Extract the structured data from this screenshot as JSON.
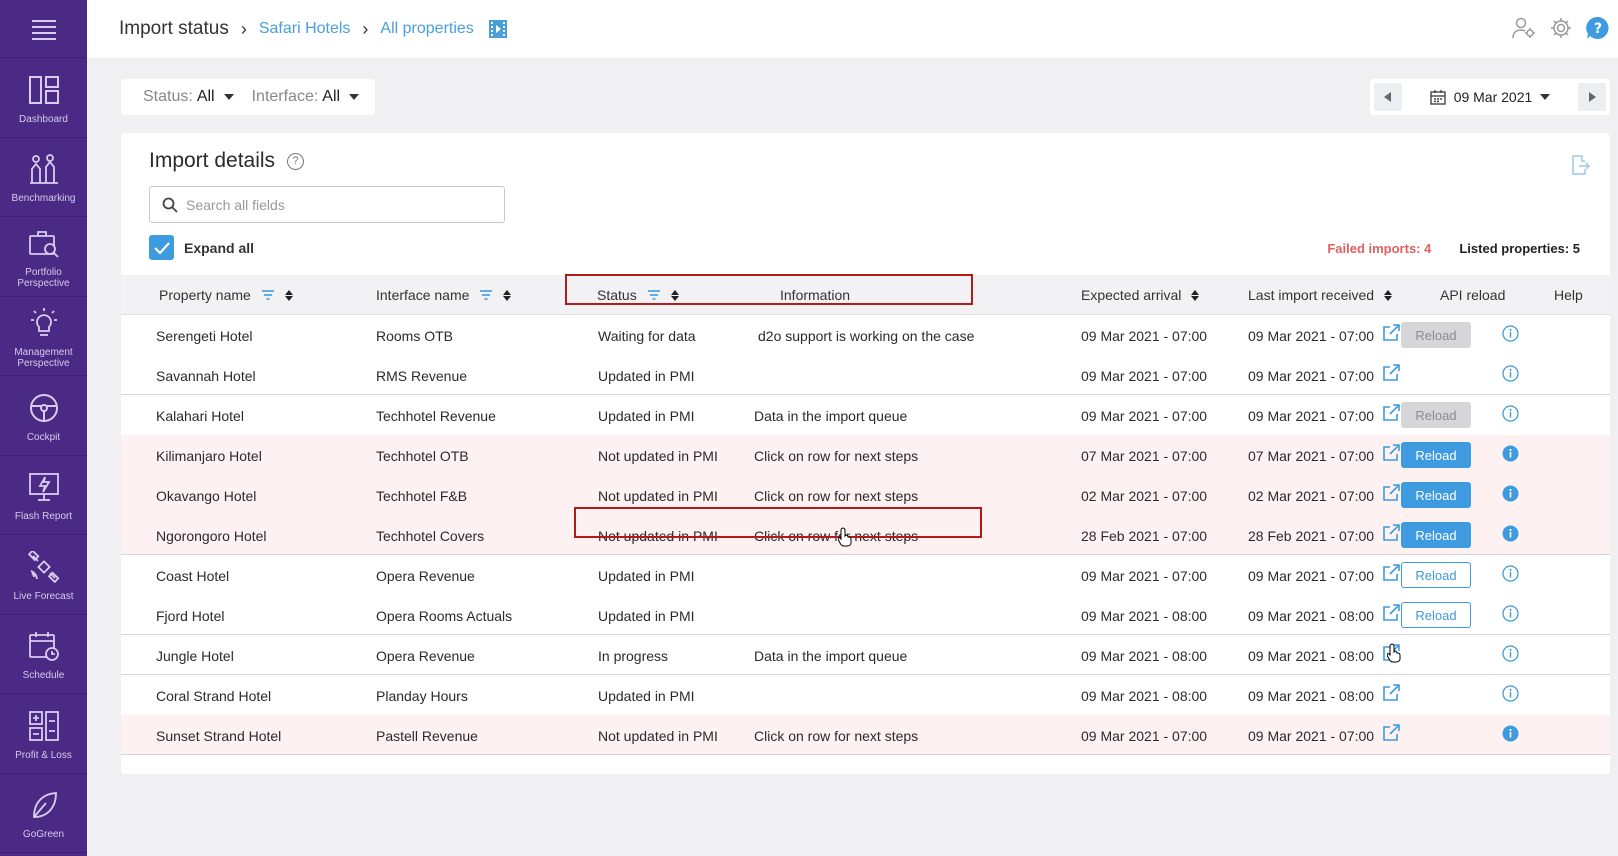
{
  "sidebar": {
    "menu_icon": "hamburger-icon",
    "items": [
      {
        "label": "Dashboard",
        "icon": "dashboard-icon"
      },
      {
        "label": "Benchmarking",
        "icon": "benchmarking-icon"
      },
      {
        "label": "Portfolio Perspective",
        "icon": "portfolio-icon"
      },
      {
        "label": "Management Perspective",
        "icon": "lightbulb-icon"
      },
      {
        "label": "Cockpit",
        "icon": "steering-wheel-icon"
      },
      {
        "label": "Flash Report",
        "icon": "flash-report-icon"
      },
      {
        "label": "Live Forecast",
        "icon": "satellite-icon"
      },
      {
        "label": "Schedule",
        "icon": "calendar-clock-icon"
      },
      {
        "label": "Profit & Loss",
        "icon": "profit-loss-icon"
      },
      {
        "label": "GoGreen",
        "icon": "leaf-icon"
      }
    ]
  },
  "header": {
    "title": "Import status",
    "breadcrumb_1": "Safari Hotels",
    "breadcrumb_2": "All properties"
  },
  "filters": {
    "status_label": "Status:",
    "status_value": "All",
    "interface_label": "Interface:",
    "interface_value": "All"
  },
  "date_picker": {
    "value": "09 Mar 2021"
  },
  "panel": {
    "title": "Import details",
    "search_placeholder": "Search all fields",
    "expand_all": "Expand all",
    "failed_imports": "Failed imports: 4",
    "listed_properties": "Listed properties: 5"
  },
  "columns": {
    "property": "Property name",
    "interface": "Interface name",
    "status": "Status",
    "information": "Information",
    "expected": "Expected arrival",
    "last_import": "Last import received",
    "api_reload": "API reload",
    "help": "Help"
  },
  "rows": [
    {
      "property": "Serengeti Hotel",
      "interface": "Rooms OTB",
      "status": "Waiting for data",
      "information": "d2o support is working on the case",
      "expected": "09 Mar 2021 - 07:00",
      "last": "09 Mar 2021 - 07:00",
      "reload": "Reload"
    },
    {
      "property": "Savannah Hotel",
      "interface": "RMS Revenue",
      "status": "Updated in PMI",
      "information": "",
      "expected": "09 Mar 2021 - 07:00",
      "last": "09 Mar 2021 - 07:00",
      "reload": ""
    },
    {
      "property": "Kalahari Hotel",
      "interface": "Techhotel Revenue",
      "status": "Updated in PMI",
      "information": "Data in the import queue",
      "expected": "09 Mar 2021 - 07:00",
      "last": "09 Mar 2021 - 07:00",
      "reload": "Reload"
    },
    {
      "property": "Kilimanjaro Hotel",
      "interface": "Techhotel OTB",
      "status": "Not updated in PMI",
      "information": "Click on row for next steps",
      "expected": "07 Mar 2021 - 07:00",
      "last": "07 Mar 2021 - 07:00",
      "reload": "Reload"
    },
    {
      "property": "Okavango Hotel",
      "interface": "Techhotel F&B",
      "status": "Not updated in PMI",
      "information": "Click on row for next steps",
      "expected": "02 Mar 2021 - 07:00",
      "last": "02 Mar 2021 - 07:00",
      "reload": "Reload"
    },
    {
      "property": "Ngorongoro Hotel",
      "interface": "Techhotel Covers",
      "status": "Not updated in PMI",
      "information": "Click on row for next steps",
      "expected": "28 Feb 2021 - 07:00",
      "last": "28 Feb 2021 - 07:00",
      "reload": "Reload"
    },
    {
      "property": "Coast Hotel",
      "interface": "Opera Revenue",
      "status": "Updated in PMI",
      "information": "",
      "expected": "09 Mar 2021 - 07:00",
      "last": "09 Mar 2021 - 07:00",
      "reload": "Reload"
    },
    {
      "property": "Fjord Hotel",
      "interface": "Opera Rooms Actuals",
      "status": "Updated in PMI",
      "information": "",
      "expected": "09 Mar 2021 - 08:00",
      "last": "09 Mar 2021 - 08:00",
      "reload": "Reload"
    },
    {
      "property": "Jungle Hotel",
      "interface": "Opera Revenue",
      "status": "In progress",
      "information": "Data in the import queue",
      "expected": "09 Mar 2021 - 08:00",
      "last": "09 Mar 2021 - 08:00",
      "reload": ""
    },
    {
      "property": "Coral Strand Hotel",
      "interface": "Planday Hours",
      "status": "Updated in PMI",
      "information": "",
      "expected": "09 Mar 2021 - 08:00",
      "last": "09 Mar 2021 - 08:00",
      "reload": ""
    },
    {
      "property": "Sunset Strand Hotel",
      "interface": "Pastell Revenue",
      "status": "Not updated in PMI",
      "information": "Click on row for next steps",
      "expected": "09 Mar 2021 - 07:00",
      "last": "09 Mar 2021 - 07:00",
      "reload": ""
    }
  ],
  "colors": {
    "sidebar": "#4b2a86",
    "accent": "#3e9be0",
    "failed": "#e06060",
    "highlight": "#b01c1c",
    "fail_row": "#fdf1f1"
  }
}
